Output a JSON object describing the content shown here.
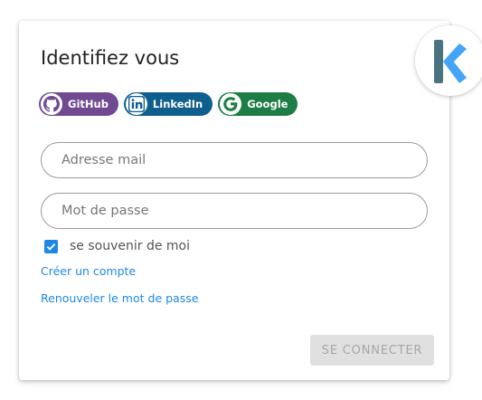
{
  "login": {
    "title": "Identifiez vous",
    "social": {
      "github": "GitHub",
      "linkedin": "LinkedIn",
      "google": "Google"
    },
    "email_placeholder": "Adresse mail",
    "password_placeholder": "Mot de passe",
    "remember_label": "se souvenir de moi",
    "remember_checked": true,
    "create_account": "Créer un compte",
    "reset_password": "Renouveler le mot de passe",
    "submit": "SE CONNECTER"
  },
  "colors": {
    "github": "#6f4a91",
    "linkedin": "#0e5e8e",
    "google": "#1e7d45",
    "accent": "#1e88e5",
    "logo_dark": "#4a7382",
    "logo_light": "#42a5f5"
  },
  "icons": [
    "github-icon",
    "linkedin-icon",
    "google-icon",
    "check-icon",
    "k-logo"
  ]
}
